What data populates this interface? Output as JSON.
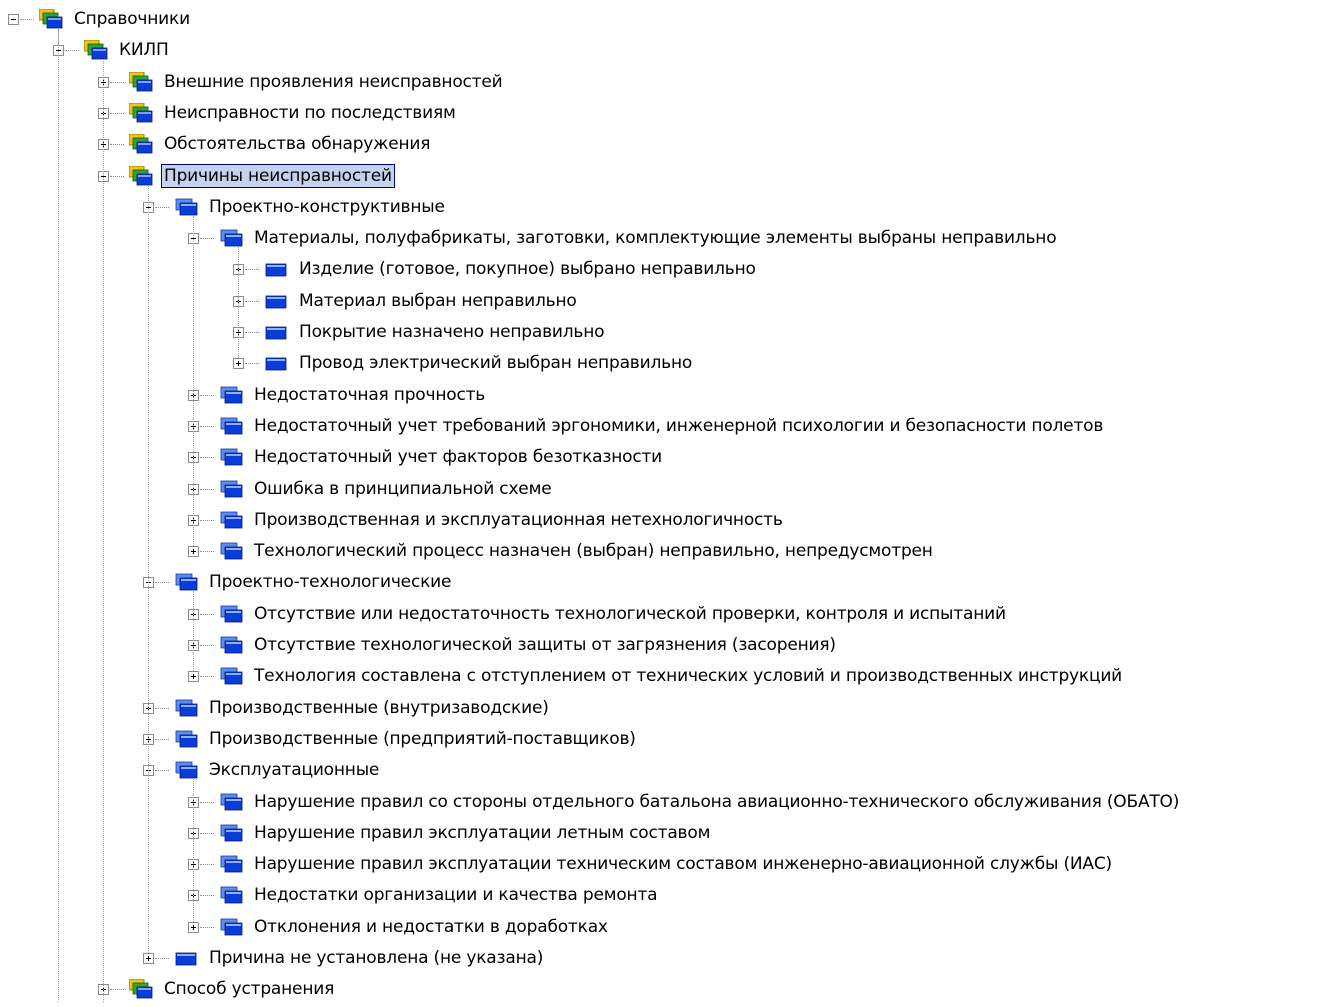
{
  "colors": {
    "connector": "#8c8c8c",
    "selection_fill": "#c4d2ec",
    "selection_border": "#000080",
    "folder_yellow": "#f4c21a",
    "folder_green": "#2da82d",
    "folder_blue": "#0a3cd8"
  },
  "tree": [
    {
      "label": "Справочники",
      "level": 0,
      "state": "expanded",
      "icon": "stacked-folder-icon"
    },
    {
      "label": "КИЛП",
      "level": 1,
      "state": "expanded",
      "icon": "stacked-folder-icon"
    },
    {
      "label": "Внешние проявления неисправностей",
      "level": 2,
      "state": "collapsed",
      "icon": "stacked-folder-icon"
    },
    {
      "label": "Неисправности по последствиям",
      "level": 2,
      "state": "collapsed",
      "icon": "stacked-folder-icon"
    },
    {
      "label": "Обстоятельства обнаружения",
      "level": 2,
      "state": "collapsed",
      "icon": "stacked-folder-icon"
    },
    {
      "label": "Причины неисправностей",
      "level": 2,
      "state": "expanded",
      "icon": "stacked-folder-icon",
      "selected": true
    },
    {
      "label": "Проектно-конструктивные",
      "level": 3,
      "state": "expanded",
      "icon": "blue-stack-icon"
    },
    {
      "label": "Материалы, полуфабрикаты, заготовки, комплектующие элементы выбраны неправильно",
      "level": 4,
      "state": "expanded",
      "icon": "blue-stack-icon"
    },
    {
      "label": "Изделие (готовое, покупное) выбрано неправильно",
      "level": 5,
      "state": "collapsed",
      "icon": "blue-item-icon"
    },
    {
      "label": "Материал выбран неправильно",
      "level": 5,
      "state": "collapsed",
      "icon": "blue-item-icon"
    },
    {
      "label": "Покрытие назначено неправильно",
      "level": 5,
      "state": "collapsed",
      "icon": "blue-item-icon"
    },
    {
      "label": "Провод электрический выбран неправильно",
      "level": 5,
      "state": "collapsed",
      "icon": "blue-item-icon"
    },
    {
      "label": "Недостаточная прочность",
      "level": 4,
      "state": "collapsed",
      "icon": "blue-stack-icon"
    },
    {
      "label": "Недостаточный учет требований эргономики, инженерной психологии и безопасности полетов",
      "level": 4,
      "state": "collapsed",
      "icon": "blue-stack-icon"
    },
    {
      "label": "Недостаточный учет факторов безотказности",
      "level": 4,
      "state": "collapsed",
      "icon": "blue-stack-icon"
    },
    {
      "label": "Ошибка в принципиальной схеме",
      "level": 4,
      "state": "collapsed",
      "icon": "blue-stack-icon"
    },
    {
      "label": "Производственная и эксплуатационная нетехнологичность",
      "level": 4,
      "state": "collapsed",
      "icon": "blue-stack-icon"
    },
    {
      "label": "Технологический процесс назначен (выбран) неправильно, непредусмотрен",
      "level": 4,
      "state": "collapsed",
      "icon": "blue-stack-icon"
    },
    {
      "label": "Проектно-технологические",
      "level": 3,
      "state": "expanded",
      "icon": "blue-stack-icon"
    },
    {
      "label": "Отсутствие или недостаточность технологической проверки, контроля и испытаний",
      "level": 4,
      "state": "collapsed",
      "icon": "blue-stack-icon"
    },
    {
      "label": "Отсутствие технологической защиты от загрязнения (засорения)",
      "level": 4,
      "state": "collapsed",
      "icon": "blue-stack-icon"
    },
    {
      "label": "Технология составлена с отступлением от технических условий и производственных инструкций",
      "level": 4,
      "state": "collapsed",
      "icon": "blue-stack-icon"
    },
    {
      "label": "Производственные (внутризаводские)",
      "level": 3,
      "state": "collapsed",
      "icon": "blue-stack-icon"
    },
    {
      "label": "Производственные (предприятий-поставщиков)",
      "level": 3,
      "state": "collapsed",
      "icon": "blue-stack-icon"
    },
    {
      "label": "Эксплуатационные",
      "level": 3,
      "state": "expanded",
      "icon": "blue-stack-icon"
    },
    {
      "label": "Нарушение правил со стороны отдельного батальона авиационно-технического обслуживания (ОБАТО)",
      "level": 4,
      "state": "collapsed",
      "icon": "blue-stack-icon"
    },
    {
      "label": "Нарушение правил эксплуатации летным составом",
      "level": 4,
      "state": "collapsed",
      "icon": "blue-stack-icon"
    },
    {
      "label": "Нарушение правил эксплуатации техническим составом инженерно-авиационной службы (ИАС)",
      "level": 4,
      "state": "collapsed",
      "icon": "blue-stack-icon"
    },
    {
      "label": "Недостатки организации и качества ремонта",
      "level": 4,
      "state": "collapsed",
      "icon": "blue-stack-icon"
    },
    {
      "label": "Отклонения и недостатки в доработках",
      "level": 4,
      "state": "collapsed",
      "icon": "blue-stack-icon"
    },
    {
      "label": "Причина не установлена (не указана)",
      "level": 3,
      "state": "collapsed",
      "icon": "blue-item-icon"
    },
    {
      "label": "Способ устранения",
      "level": 2,
      "state": "collapsed",
      "icon": "stacked-folder-icon"
    }
  ]
}
